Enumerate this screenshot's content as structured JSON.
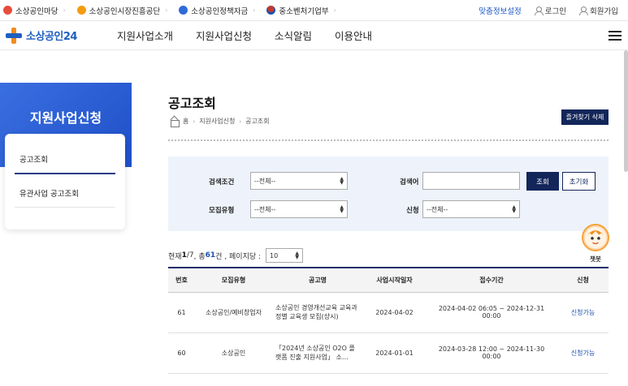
{
  "topbar": {
    "sites": [
      {
        "label": "소상공인마당",
        "color": "#e74c3c"
      },
      {
        "label": "소상공인시장진흥공단",
        "color": "#f39c12"
      },
      {
        "label": "소상공인정책자금",
        "color": "#2e6bd8"
      },
      {
        "label": "중소벤처기업부",
        "color": "#c0392b"
      }
    ],
    "custom_info": "맞춤정보설정",
    "login": "로그인",
    "signup": "회원가입"
  },
  "header": {
    "brand": "소상공인24",
    "menu": [
      "지원사업소개",
      "지원사업신청",
      "소식알림",
      "이용안내"
    ]
  },
  "sidebar": {
    "title": "지원사업신청",
    "items": [
      "공고조회",
      "유관사업 공고조회"
    ]
  },
  "content": {
    "title": "공고조회",
    "breadcrumb": [
      "홈",
      "지원사업신청",
      "공고조회"
    ],
    "fav_delete": "즐겨찾기 삭제"
  },
  "search": {
    "cond_label": "검색조건",
    "cond_value": "--전체--",
    "keyword_label": "검색어",
    "keyword_value": "",
    "type_label": "모집유형",
    "type_value": "--전체--",
    "apply_label": "신청",
    "apply_value": "--전체--",
    "search_btn": "조회",
    "reset_btn": "초기화"
  },
  "summary": {
    "prefix": "현재 ",
    "page": "1",
    "slash_total": "/7",
    "middle": " , 총 ",
    "count": "61",
    "suffix": "건 , 페이지당 :",
    "page_size": "10"
  },
  "chatbot": {
    "label": "챗봇"
  },
  "table": {
    "headers": [
      "번호",
      "모집유형",
      "공고명",
      "사업시작일자",
      "접수기간",
      "신청"
    ],
    "rows": [
      {
        "no": "61",
        "type": "소상공인/예비창업자",
        "title": "소상공인 경영개선교육 교육과정별 교육생 모집(상시)",
        "start": "2024-04-02",
        "period": "2024-04-02 06:05 ~ 2024-12-31 00:00",
        "status": "신청가능"
      },
      {
        "no": "60",
        "type": "소상공인",
        "title": "「2024년 소상공인 O2O 플랫폼 진출 지원사업」 소…",
        "start": "2024-01-01",
        "period": "2024-03-28 12:00 ~ 2024-11-30 00:00",
        "status": "신청가능"
      }
    ]
  }
}
